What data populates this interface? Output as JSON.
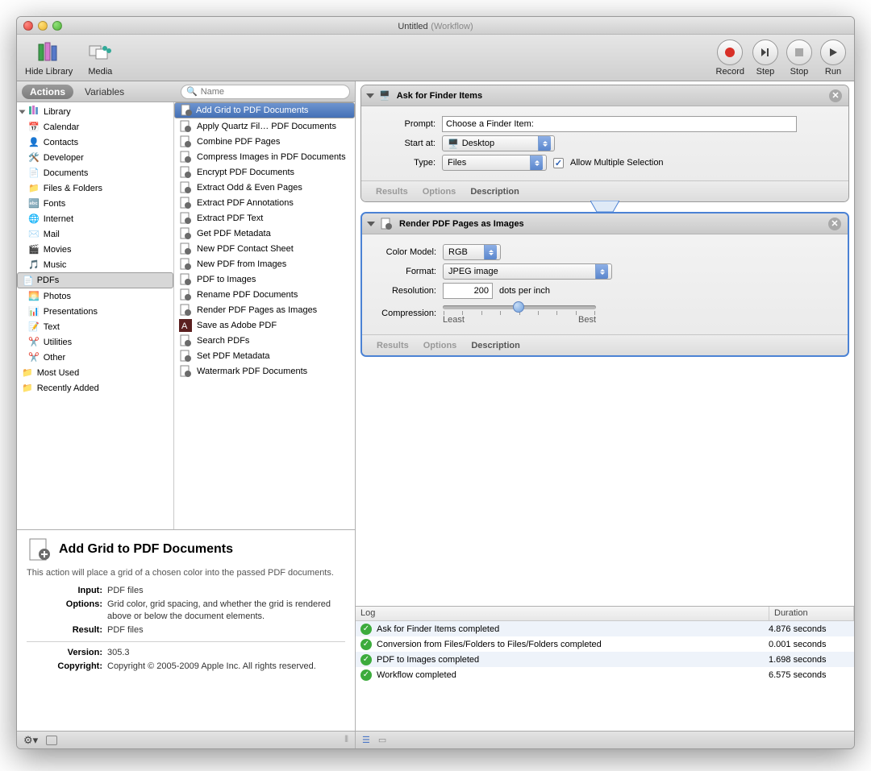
{
  "title": {
    "name": "Untitled",
    "type": "(Workflow)"
  },
  "toolbar": {
    "hide_library": "Hide Library",
    "media": "Media",
    "record": "Record",
    "step": "Step",
    "stop": "Stop",
    "run": "Run"
  },
  "sidebar_tabs": {
    "actions": "Actions",
    "variables": "Variables",
    "search_placeholder": "Name"
  },
  "library": {
    "root": "Library",
    "items": [
      "Calendar",
      "Contacts",
      "Developer",
      "Documents",
      "Files & Folders",
      "Fonts",
      "Internet",
      "Mail",
      "Movies",
      "Music",
      "PDFs",
      "Photos",
      "Presentations",
      "Text",
      "Utilities",
      "Other"
    ],
    "selected": "PDFs",
    "most_used": "Most Used",
    "recently_added": "Recently Added"
  },
  "actions": {
    "selected": "Add Grid to PDF Documents",
    "items": [
      "Add Grid to PDF Documents",
      "Apply Quartz Fil… PDF Documents",
      "Combine PDF Pages",
      "Compress Images in PDF Documents",
      "Encrypt PDF Documents",
      "Extract Odd & Even Pages",
      "Extract PDF Annotations",
      "Extract PDF Text",
      "Get PDF Metadata",
      "New PDF Contact Sheet",
      "New PDF from Images",
      "PDF to Images",
      "Rename PDF Documents",
      "Render PDF Pages as Images",
      "Save as Adobe PDF",
      "Search PDFs",
      "Set PDF Metadata",
      "Watermark PDF Documents"
    ]
  },
  "info": {
    "title": "Add Grid to PDF Documents",
    "desc": "This action will place a grid of a chosen color into the passed PDF documents.",
    "input_k": "Input:",
    "input_v": "PDF files",
    "options_k": "Options:",
    "options_v": "Grid color, grid spacing, and whether the grid is rendered above or below the document elements.",
    "result_k": "Result:",
    "result_v": "PDF files",
    "version_k": "Version:",
    "version_v": "305.3",
    "copyright_k": "Copyright:",
    "copyright_v": "Copyright © 2005-2009 Apple Inc.  All rights reserved."
  },
  "step1": {
    "title": "Ask for Finder Items",
    "prompt_lab": "Prompt:",
    "prompt_val": "Choose a Finder Item:",
    "start_lab": "Start at:",
    "start_val": "Desktop",
    "type_lab": "Type:",
    "type_val": "Files",
    "allow": "Allow Multiple Selection",
    "tabs": {
      "results": "Results",
      "options": "Options",
      "description": "Description"
    }
  },
  "step2": {
    "title": "Render PDF Pages as Images",
    "color_lab": "Color Model:",
    "color_val": "RGB",
    "format_lab": "Format:",
    "format_val": "JPEG image",
    "res_lab": "Resolution:",
    "res_val": "200",
    "res_unit": "dots per inch",
    "comp_lab": "Compression:",
    "comp_least": "Least",
    "comp_best": "Best",
    "tabs": {
      "results": "Results",
      "options": "Options",
      "description": "Description"
    }
  },
  "log": {
    "h_log": "Log",
    "h_dur": "Duration",
    "rows": [
      {
        "msg": "Ask for Finder Items completed",
        "dur": "4.876 seconds"
      },
      {
        "msg": "Conversion from Files/Folders to Files/Folders completed",
        "dur": "0.001 seconds"
      },
      {
        "msg": "PDF to Images completed",
        "dur": "1.698 seconds"
      },
      {
        "msg": "Workflow completed",
        "dur": "6.575 seconds"
      }
    ]
  }
}
